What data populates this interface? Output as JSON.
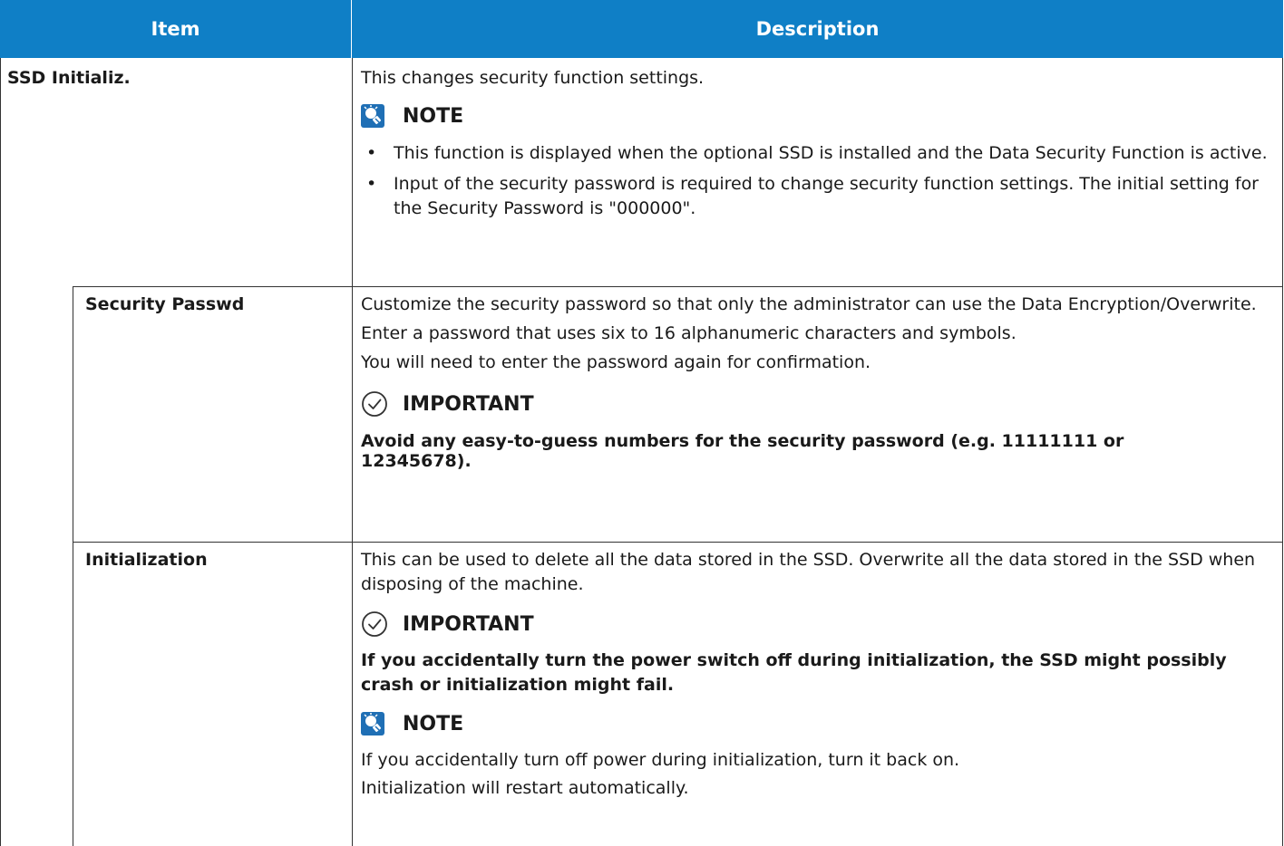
{
  "header": {
    "item": "Item",
    "description": "Description"
  },
  "rows": {
    "ssd": {
      "label": "SSD Initializ.",
      "desc": "This changes security function settings.",
      "note_title": "NOTE",
      "bullet1": "This function is displayed when the optional SSD is installed and the Data Security Function is active.",
      "bullet2": "Input of the security password is required to change security function settings. The initial setting for the Security Password is \"000000\"."
    },
    "security_passwd": {
      "label": "Security Passwd",
      "p1": "Customize the security password so that only the administrator can use the Data Encryption/Overwrite.",
      "p2": "Enter a password that uses six to 16 alphanumeric characters and symbols.",
      "p3": "You will need to enter the password again for confirmation.",
      "important_title": "IMPORTANT",
      "important_text": "Avoid any easy-to-guess numbers for the security password (e.g. 11111111 or 12345678)."
    },
    "initialization": {
      "label": "Initialization",
      "p1": "This can be used to delete all the data stored in the SSD. Overwrite all the data stored in the SSD when disposing of the machine.",
      "important_title": "IMPORTANT",
      "important_text": "If you accidentally turn the power switch off during initialization, the SSD might possibly crash or initialization might fail.",
      "note_title": "NOTE",
      "note_p1": "If you accidentally turn off power during initialization, turn it back on.",
      "note_p2": "Initialization will restart automatically."
    }
  },
  "colors": {
    "header_bg": "#0f7fc6",
    "border": "#333333",
    "icon_blue": "#1f6fb5"
  },
  "icons": {
    "note": "lightbulb-note-icon",
    "important": "check-circle-icon"
  }
}
